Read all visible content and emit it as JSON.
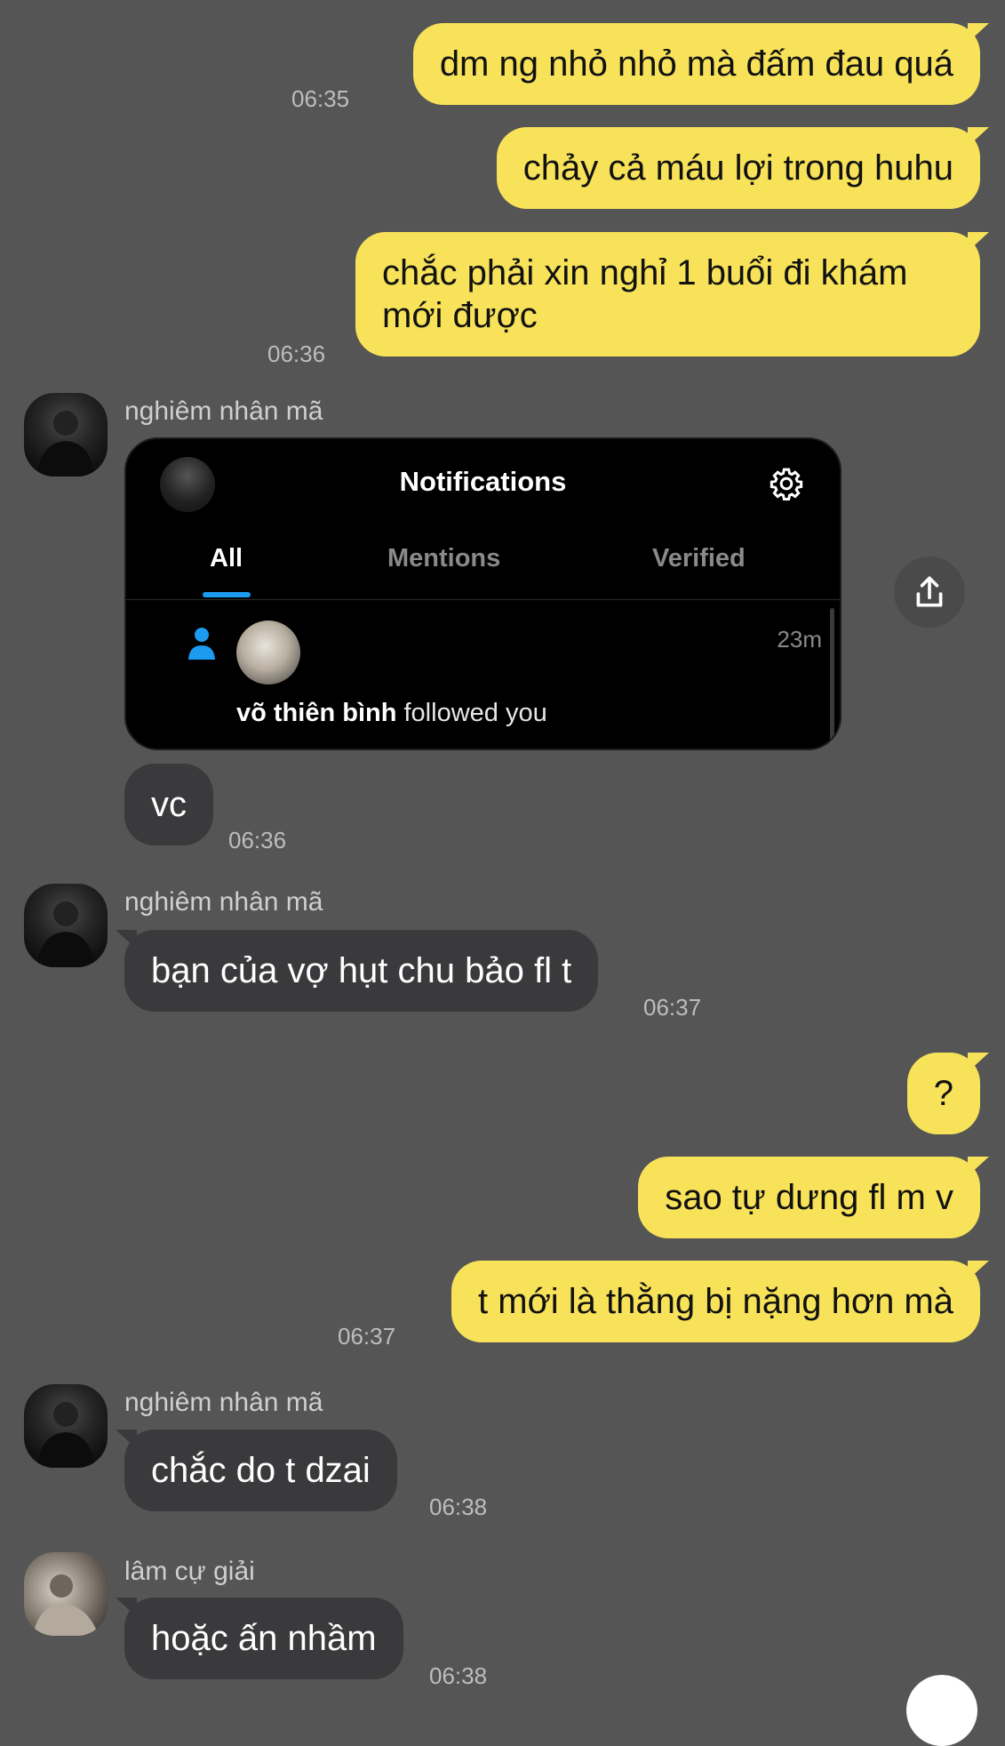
{
  "messages": {
    "m1": {
      "text": "dm ng nhỏ nhỏ mà đấm đau quá",
      "time": "06:35"
    },
    "m2": {
      "text": "chảy cả máu lợi trong huhu"
    },
    "m3": {
      "line1": "chắc phải xin nghỉ 1 buổi đi khám",
      "line2": "mới được",
      "time": "06:36"
    },
    "m4": {
      "sender": "nghiêm nhân mã"
    },
    "m5": {
      "text": "vc",
      "time": "06:36"
    },
    "m6": {
      "sender": "nghiêm nhân mã",
      "text": "bạn của vợ hụt chu bảo fl t",
      "time": "06:37"
    },
    "m7": {
      "text": "?"
    },
    "m8": {
      "text": "sao tự dưng fl m v"
    },
    "m9": {
      "text": "t mới là thằng bị nặng hơn mà",
      "time": "06:37"
    },
    "m10": {
      "sender": "nghiêm nhân mã",
      "text": "chắc do t dzai",
      "time": "06:38"
    },
    "m11": {
      "sender": "lâm cự giải",
      "text": "hoặc ấn nhầm",
      "time": "06:38"
    }
  },
  "screenshot": {
    "title": "Notifications",
    "tabs": [
      "All",
      "Mentions",
      "Verified"
    ],
    "active_tab": "All",
    "time_ago": "23m",
    "follower_name": "võ thiên bình",
    "follow_action": "followed you"
  },
  "colors": {
    "background": "#555555",
    "my_bubble": "#f7e259",
    "their_bubble": "#3a3a3c",
    "accent_blue": "#1d9bf0"
  },
  "icons": [
    "share-icon",
    "gear-icon",
    "person-icon"
  ]
}
